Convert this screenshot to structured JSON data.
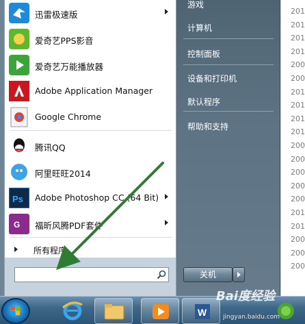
{
  "background_list": {
    "years": [
      "201",
      "201",
      "201",
      "201",
      "200",
      "200",
      "201",
      "201",
      "201",
      "201",
      "200",
      "200",
      "200",
      "200",
      "200",
      "201",
      "201",
      "200",
      "200",
      "200"
    ]
  },
  "start_menu": {
    "programs": [
      {
        "label": "迅雷极速版",
        "icon": "xunlei-icon",
        "has_submenu": true,
        "color": "#1e8ad8"
      },
      {
        "label": "爱奇艺PPS影音",
        "icon": "pps-icon",
        "has_submenu": false,
        "color": "#5db830"
      },
      {
        "label": "爱奇艺万能播放器",
        "icon": "iqiyi-player-icon",
        "has_submenu": false,
        "color": "#3aa63a"
      },
      {
        "label": "Adobe Application Manager",
        "icon": "adobe-icon",
        "has_submenu": false,
        "color": "#c8181e"
      },
      {
        "label": "Google Chrome",
        "icon": "chrome-icon",
        "has_submenu": false,
        "color": "#e8eaed"
      },
      {
        "label": "腾讯QQ",
        "icon": "qq-icon",
        "has_submenu": false,
        "color": "#111111"
      },
      {
        "label": "阿里旺旺2014",
        "icon": "aliwangwang-icon",
        "has_submenu": false,
        "color": "#3ba3e8"
      },
      {
        "label": "Adobe Photoshop CC (64 Bit)",
        "icon": "photoshop-icon",
        "has_submenu": true,
        "color": "#0e2a45"
      },
      {
        "label": "福昕风腾PDF套件",
        "icon": "foxit-pdf-icon",
        "has_submenu": true,
        "color": "#8b2b8f"
      }
    ],
    "all_programs_label": "所有程序",
    "search_placeholder": "",
    "right_pane": {
      "items": [
        "游戏",
        "计算机",
        "控制面板",
        "设备和打印机",
        "默认程序",
        "帮助和支持"
      ],
      "shutdown_label": "关机"
    }
  },
  "taskbar": {
    "items": [
      "start-orb",
      "internet-explorer",
      "file-explorer",
      "media-player",
      "word",
      "360-browser"
    ]
  },
  "watermark": {
    "text": "Bai度经验",
    "sub": "jingyan.baidu.com"
  }
}
